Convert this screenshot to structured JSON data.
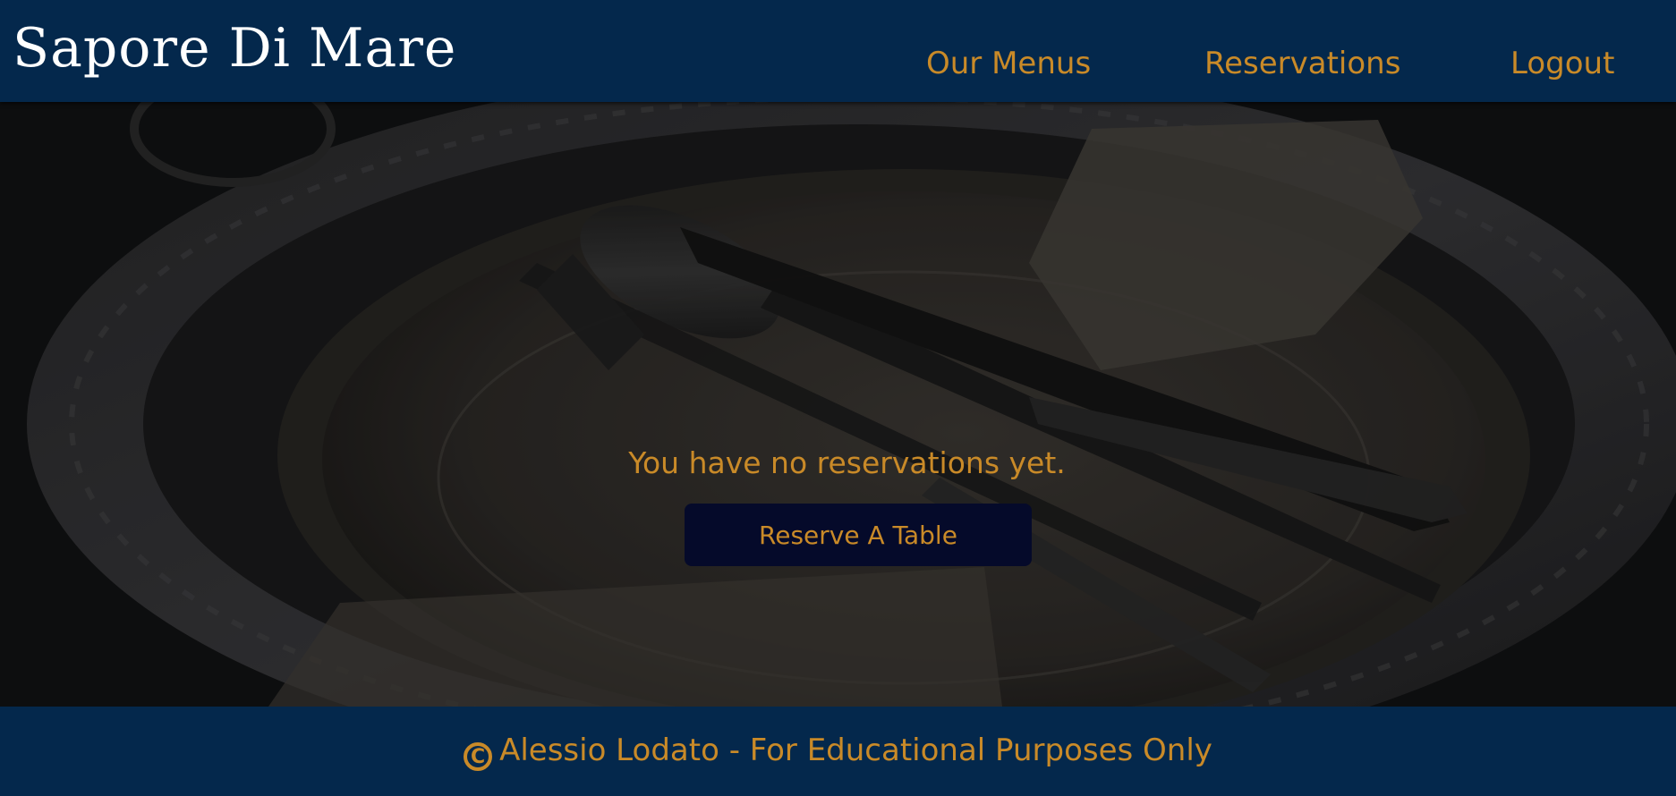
{
  "header": {
    "brand": "Sapore Di Mare",
    "nav": {
      "menus": "Our Menus",
      "reservations": "Reservations",
      "logout": "Logout"
    }
  },
  "main": {
    "empty_message": "You have no reservations yet.",
    "reserve_button": "Reserve A Table"
  },
  "footer": {
    "copyright_symbol": "C",
    "text": "Alessio Lodato - For Educational Purposes Only"
  },
  "colors": {
    "header_bg": "#04284c",
    "accent": "#c98a28",
    "button_bg": "#050a2a",
    "brand_text": "#ffffff"
  },
  "icons": {
    "copyright": "copyright-icon",
    "hero_image": "place-setting-photo"
  }
}
